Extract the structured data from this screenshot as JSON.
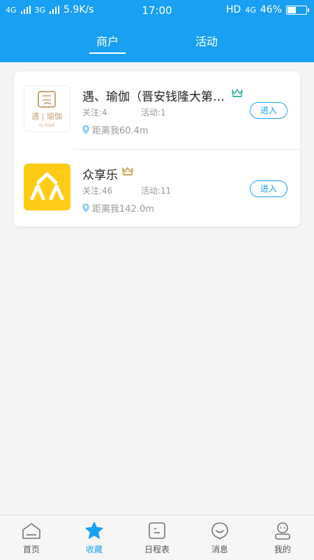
{
  "status_bar": {
    "left": "4G",
    "left2": "3G",
    "speed": "5.9K/s",
    "time": "17:00",
    "hd": "HD",
    "net": "4G",
    "battery": "46%",
    "battery_level": 0.46
  },
  "header": {
    "tabs": [
      {
        "label": "商户",
        "active": true
      },
      {
        "label": "活动",
        "active": false
      }
    ]
  },
  "merchants": [
    {
      "name": "遇、瑜伽（晋安钱隆大第…",
      "logo_text": "遇 | 瑜伽",
      "logo_sub": "YU YOGA",
      "crown_color": "#3fb8a3",
      "follow_label": "关注:4",
      "activity_label": "活动:1",
      "distance": "距离我60.4m",
      "enter_label": "进入"
    },
    {
      "name": "众享乐",
      "crown_color": "#d4a04a",
      "follow_label": "关注:46",
      "activity_label": "活动:11",
      "distance": "距离我142.0m",
      "enter_label": "进入"
    }
  ],
  "tabbar": {
    "items": [
      {
        "label": "首页",
        "icon": "home-icon",
        "active": false
      },
      {
        "label": "收藏",
        "icon": "star-icon",
        "active": true
      },
      {
        "label": "日程表",
        "icon": "schedule-icon",
        "active": false
      },
      {
        "label": "消息",
        "icon": "message-icon",
        "active": false
      },
      {
        "label": "我的",
        "icon": "profile-icon",
        "active": false
      }
    ]
  },
  "colors": {
    "accent": "#1aa0f3",
    "background": "#f4f4f4"
  }
}
